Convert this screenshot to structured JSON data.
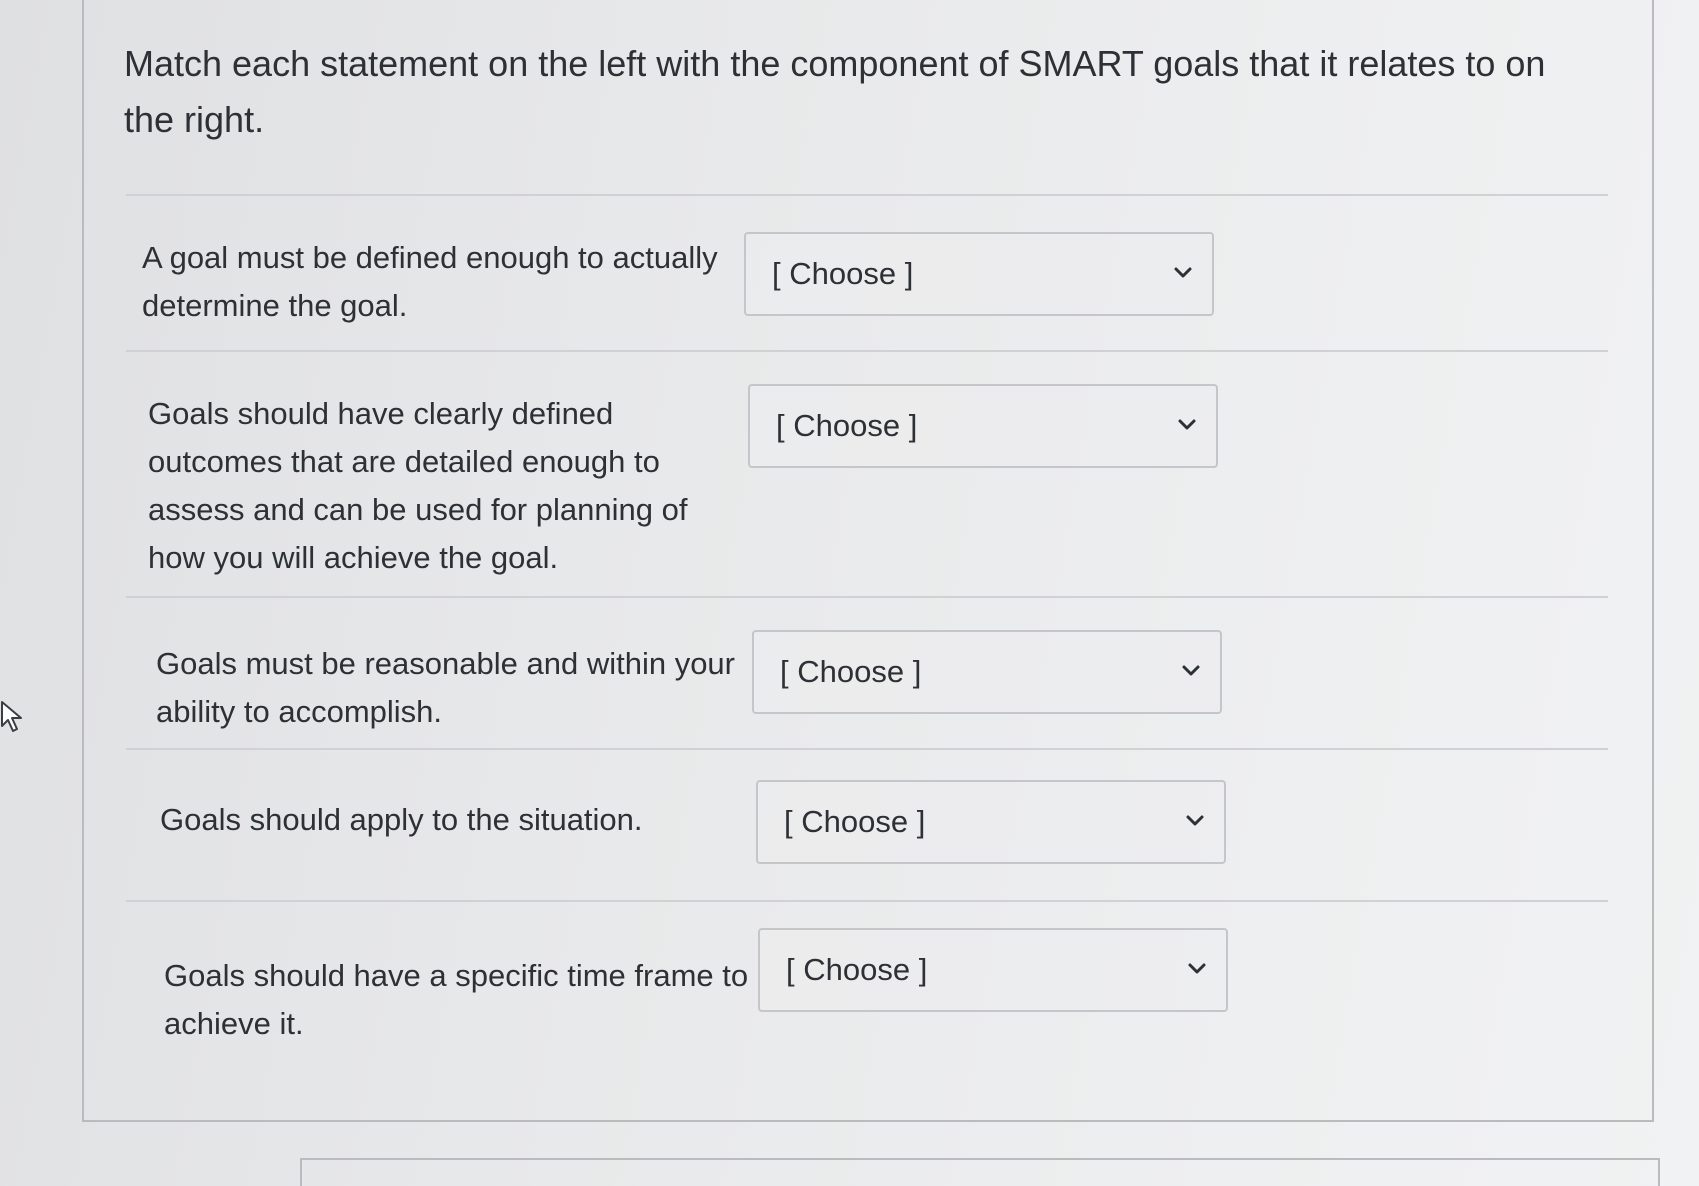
{
  "question": {
    "text": "Match each statement on the left with the component of SMART goals that it relates to on the right."
  },
  "rows": [
    {
      "statement": "A goal must be defined enough to actually determine the goal.",
      "select_value": "[ Choose ]"
    },
    {
      "statement": "Goals should have clearly defined outcomes that are detailed enough to assess and can be used for planning of how you will achieve the goal.",
      "select_value": "[ Choose ]"
    },
    {
      "statement": "Goals must be reasonable and within your ability to accomplish.",
      "select_value": "[ Choose ]"
    },
    {
      "statement": "Goals should apply to the situation.",
      "select_value": "[ Choose ]"
    },
    {
      "statement": "Goals should have a specific time frame to achieve it.",
      "select_value": "[ Choose ]"
    }
  ],
  "icons": {
    "dropdown": "chevron-down-icon",
    "pointer": "mouse-cursor-icon"
  }
}
